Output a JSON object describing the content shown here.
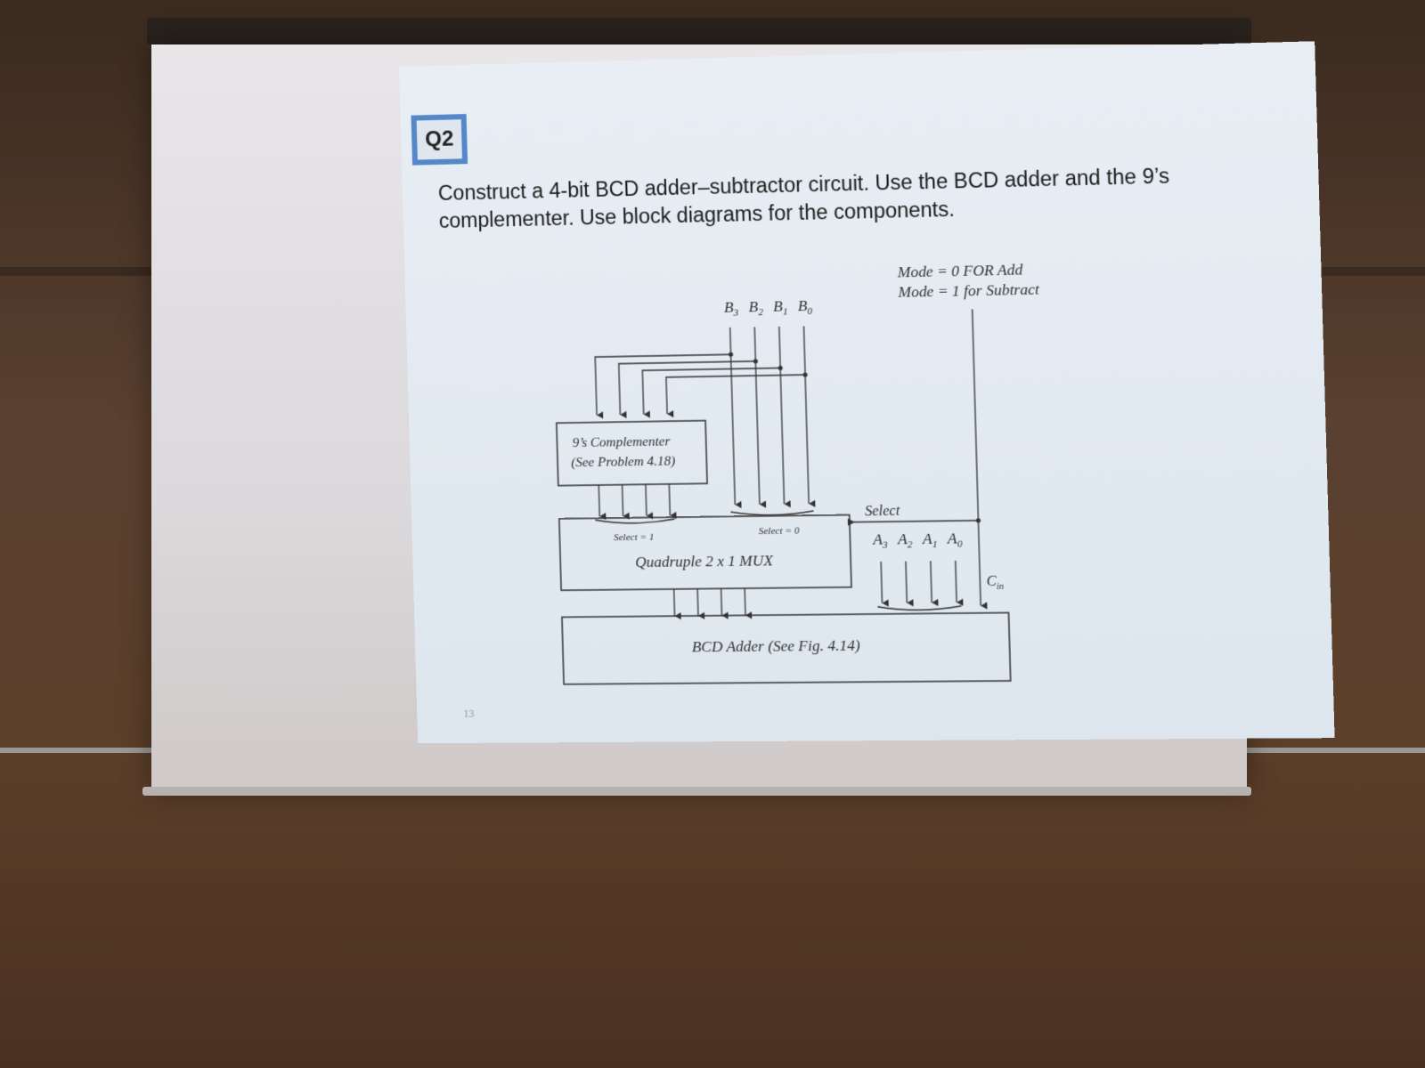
{
  "slide": {
    "badge": "Q2",
    "question_line1": "Construct a 4-bit BCD adder–subtractor circuit. Use the BCD adder and the 9’s",
    "question_line2": "complementer. Use block diagrams for the components.",
    "slide_number": "13"
  },
  "diagram": {
    "mode_line1": "Mode = 0 FOR Add",
    "mode_line2": "Mode = 1 for Subtract",
    "b_inputs": [
      "B",
      "B",
      "B",
      "B"
    ],
    "b_subscripts": [
      "3",
      "2",
      "1",
      "0"
    ],
    "a_inputs": [
      "A",
      "A",
      "A",
      "A"
    ],
    "a_subscripts": [
      "3",
      "2",
      "1",
      "0"
    ],
    "complementer_line1": "9’s Complementer",
    "complementer_line2": "(See Problem 4.18)",
    "select1": "Select = 1",
    "select0": "Select = 0",
    "mux_label": "Quadruple 2 x 1 MUX",
    "select_label": "Select",
    "cin": "C",
    "cin_sub": "in",
    "adder_label": "BCD Adder (See Fig. 4.14)"
  },
  "colors": {
    "projector_screen": "#dcd9dc",
    "slide_background": "#e4ebf2",
    "badge_border": "#5588c8",
    "wall": "#5a4030"
  }
}
